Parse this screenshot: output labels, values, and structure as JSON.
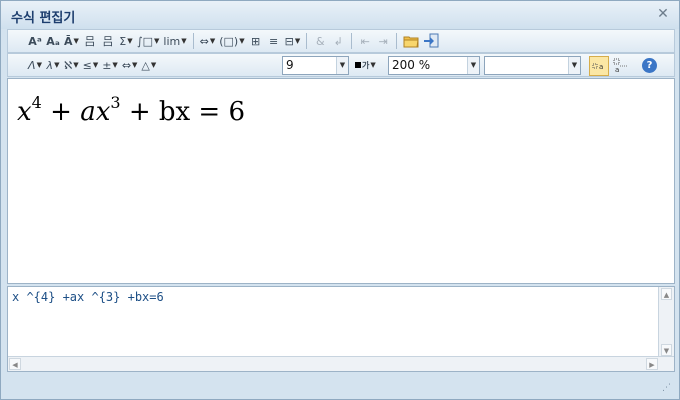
{
  "window": {
    "title": "수식 편집기"
  },
  "toolbar1": {
    "items": [
      "Aᵃ",
      "Aₐ",
      "Ā",
      "吕",
      "吕",
      "Σ",
      "∫□",
      "lim",
      "⇔",
      "(□)",
      "⊞",
      "≡",
      "⊟",
      "&",
      "↲",
      "⇤",
      "⇥"
    ]
  },
  "toolbar2": {
    "font_size": "9",
    "color_label": "가",
    "zoom": "200 %",
    "font_name": "",
    "symbols": [
      "Λ",
      "λ",
      "ℵ",
      "≤",
      "±",
      "⇔",
      "△"
    ]
  },
  "formula": {
    "display": {
      "x": "x",
      "exp1": "4",
      "a": "ax",
      "exp2": "3",
      "rest": "+ bx = 6"
    },
    "source": "x ^{4} +ax ^{3} +bx=6"
  }
}
